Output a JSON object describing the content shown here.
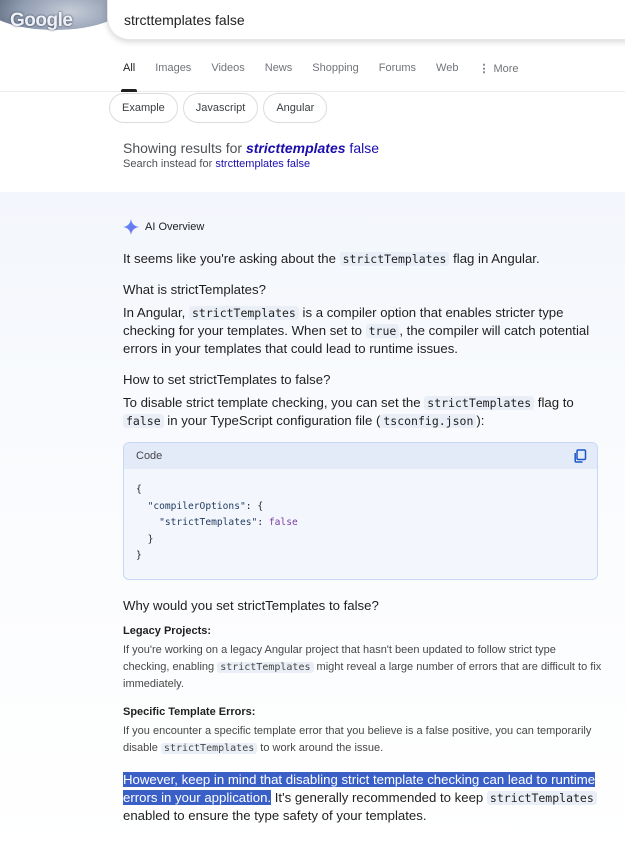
{
  "logo": {
    "text": "Google"
  },
  "search": {
    "query": "strcttemplates false"
  },
  "tabs": [
    {
      "label": "All",
      "active": true
    },
    {
      "label": "Images"
    },
    {
      "label": "Videos"
    },
    {
      "label": "News"
    },
    {
      "label": "Shopping"
    },
    {
      "label": "Forums"
    },
    {
      "label": "Web"
    },
    {
      "label": "More"
    }
  ],
  "chips": [
    "Example",
    "Javascript",
    "Angular"
  ],
  "spelling": {
    "prefix": "Showing results for ",
    "corrected_bold": "stricttemplates",
    "corrected_rest": " false",
    "instead_prefix": "Search instead for ",
    "instead_query": "strcttemplates false"
  },
  "ai": {
    "title": "AI Overview",
    "intro_a": "It seems like you're asking about the ",
    "intro_code": "strictTemplates",
    "intro_b": " flag in Angular.",
    "h1": "What is strictTemplates?",
    "p1_a": "In Angular, ",
    "p1_code": "strictTemplates",
    "p1_b": " is a compiler option that enables stricter type checking for your templates. When set to ",
    "p1_code2": "true",
    "p1_c": ", the compiler will catch potential errors in your templates that could lead to runtime issues.",
    "h2": "How to set strictTemplates to false?",
    "p2_a": "To disable strict template checking, you can set the ",
    "p2_code": "strictTemplates",
    "p2_b": " flag to ",
    "p2_code2": "false",
    "p2_c": " in your TypeScript configuration file (",
    "p2_code3": "tsconfig.json",
    "p2_d": "):",
    "code_label": "Code",
    "code": {
      "l1": "{",
      "l2_key": "\"compilerOptions\"",
      "l2_rest": ": {",
      "l3_key": "\"strictTemplates\"",
      "l3_sep": ": ",
      "l3_val": "false",
      "l4": "}",
      "l5": "}"
    },
    "h3": "Why would you set strictTemplates to false?",
    "s1_title": "Legacy Projects:",
    "s1_a": "If you're working on a legacy Angular project that hasn't been updated to follow strict type checking, enabling ",
    "s1_code": "strictTemplates",
    "s1_b": " might reveal a large number of errors that are difficult to fix immediately.",
    "s2_title": "Specific Template Errors:",
    "s2_a": "If you encounter a specific template error that you believe is a false positive, you can temporarily disable ",
    "s2_code": "strictTemplates",
    "s2_b": " to work around the issue.",
    "final_hl": "However, keep in mind that disabling strict template checking can lead to runtime errors in your application.",
    "final_a": " It's generally recommended to keep ",
    "final_code": "strictTemplates",
    "final_b": " enabled to ensure the type safety of your templates."
  }
}
